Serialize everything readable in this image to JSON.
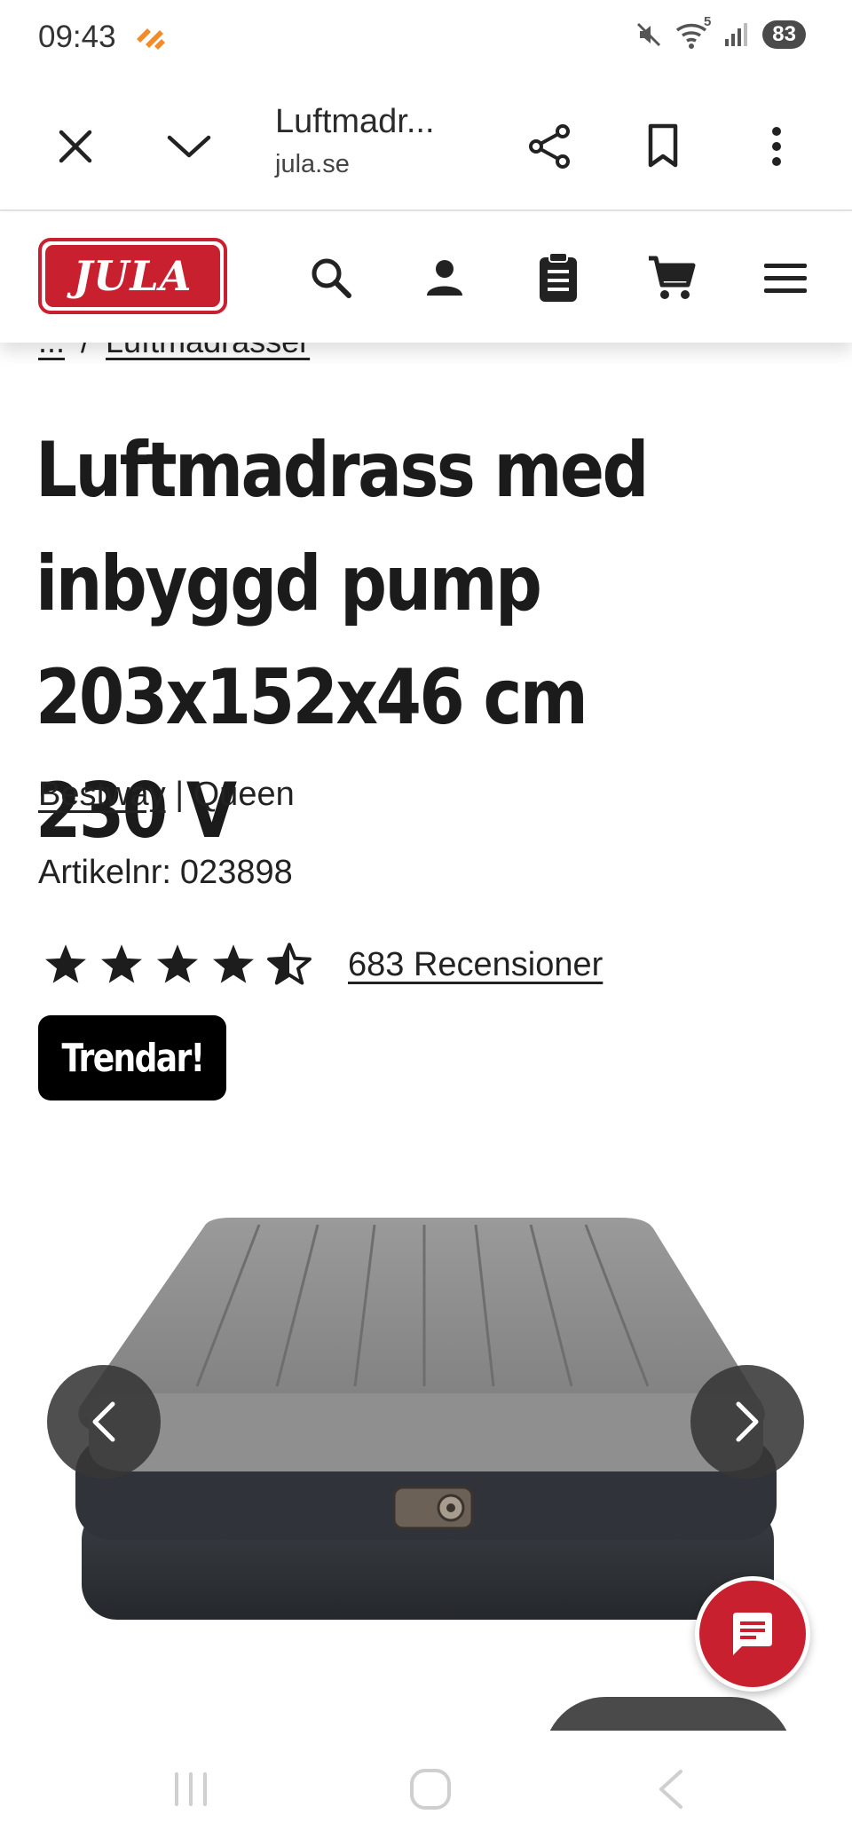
{
  "status_bar": {
    "time": "09:43",
    "battery": "83",
    "network_badge": "5"
  },
  "browser": {
    "page_title": "Luftmadr...",
    "domain": "jula.se"
  },
  "site": {
    "logo_text": "JULA",
    "brand_color": "#c8202f"
  },
  "breadcrumb": {
    "ellipsis": "...",
    "separator": "/",
    "current": "Luftmadrasser"
  },
  "product": {
    "title": "Luftmadrass med inbyggd pump 203x152x46 cm 230 V",
    "brand": "Bestway",
    "brand_separator": "|",
    "variant": "Queen",
    "article_label": "Artikelnr:",
    "article_number": "023898",
    "rating": 4.5,
    "rating_max": 5,
    "review_count": "683 Recensioner",
    "badge": "Trendar!"
  },
  "icons": {
    "header": [
      "search-icon",
      "account-icon",
      "list-icon",
      "cart-icon",
      "menu-icon"
    ],
    "browser": [
      "close-icon",
      "chevron-down-icon",
      "share-icon",
      "bookmark-icon",
      "more-icon"
    ]
  }
}
